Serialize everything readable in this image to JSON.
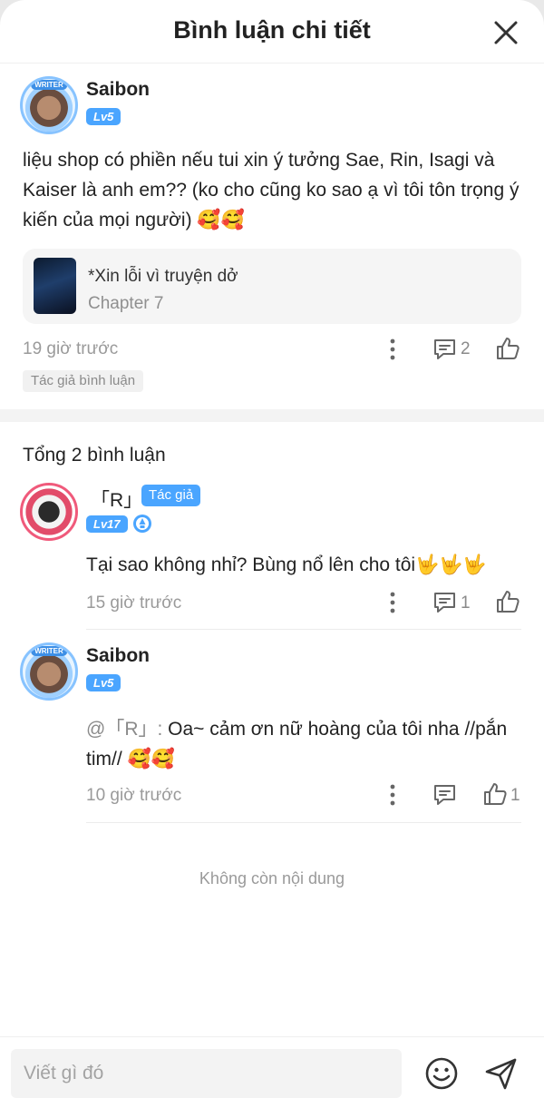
{
  "header": {
    "title": "Bình luận chi tiết"
  },
  "main_comment": {
    "user_name": "Saibon",
    "level": "Lv5",
    "avatar_badge": "WRITER",
    "content": "liệu shop có phiền nếu tui xin ý tưởng Sae, Rin, Isagi và Kaiser là anh em?? (ko cho cũng ko sao ạ vì tôi tôn trọng ý kiến của mọi người) 🥰🥰",
    "chapter": {
      "title": "*Xin lỗi vì truyện dở",
      "subtitle": "Chapter 7"
    },
    "time": "19 giờ trước",
    "reply_count": "2",
    "author_tag": "Tác giả bình luận"
  },
  "replies_header": {
    "total": "Tổng 2 bình luận"
  },
  "replies": [
    {
      "user_name": "「R」",
      "author_tag": "Tác giả",
      "level": "Lv17",
      "content": "Tại sao không nhỉ? Bùng nổ lên cho tôi🤟🤟🤟",
      "time": "15 giờ trước",
      "reply_count": "1"
    },
    {
      "user_name": "Saibon",
      "level": "Lv5",
      "avatar_badge": "WRITER",
      "mention": "@「R」: ",
      "content": "Oa~ cảm ơn nữ hoàng của tôi nha //pắn tim// 🥰🥰",
      "time": "10 giờ trước",
      "like_count": "1"
    }
  ],
  "end_text": "Không còn nội dung",
  "composer": {
    "placeholder": "Viết gì đó"
  },
  "colors": {
    "accent": "#4aa5ff",
    "muted": "#9a9a9a",
    "text": "#222222"
  }
}
